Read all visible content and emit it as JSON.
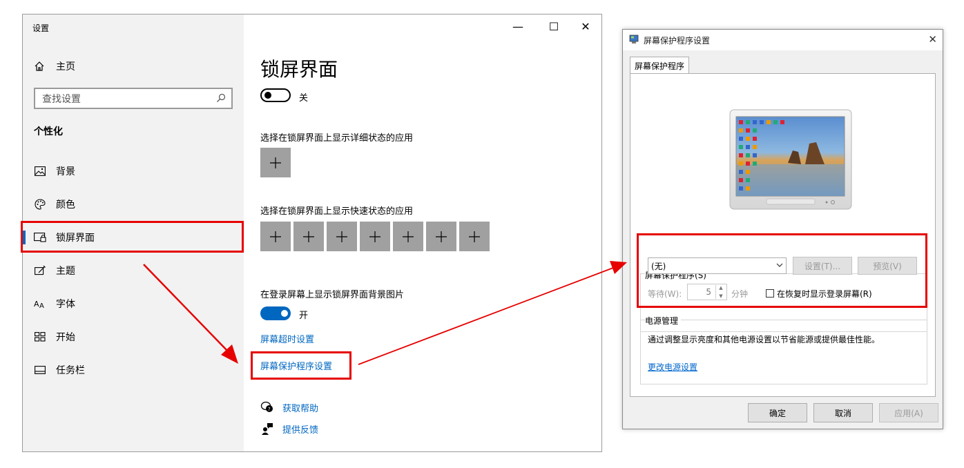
{
  "settings": {
    "app_title": "设置",
    "home_label": "主页",
    "search_placeholder": "查找设置",
    "section_label": "个性化",
    "nav": [
      {
        "label": "背景",
        "icon": "picture-icon"
      },
      {
        "label": "颜色",
        "icon": "palette-icon"
      },
      {
        "label": "锁屏界面",
        "icon": "lockscreen-icon",
        "active": true
      },
      {
        "label": "主题",
        "icon": "theme-icon"
      },
      {
        "label": "字体",
        "icon": "font-icon"
      },
      {
        "label": "开始",
        "icon": "start-icon"
      },
      {
        "label": "任务栏",
        "icon": "taskbar-icon"
      }
    ],
    "window_controls": {
      "minimize": "—",
      "maximize": "☐",
      "close": "✕"
    },
    "main": {
      "title": "锁屏界面",
      "toggle1_state": "关",
      "detailed_status_label": "选择在锁屏界面上显示详细状态的应用",
      "quick_status_label": "选择在锁屏界面上显示快速状态的应用",
      "quick_slots": 7,
      "signin_bg_label": "在登录屏幕上显示锁屏界面背景图片",
      "toggle2_state": "开",
      "timeout_link": "屏幕超时设置",
      "screensaver_link": "屏幕保护程序设置",
      "help_link": "获取帮助",
      "feedback_link": "提供反馈"
    }
  },
  "dialog": {
    "title": "屏幕保护程序设置",
    "close": "✕",
    "tab_label": "屏幕保护程序",
    "screensaver_group_label": "屏幕保护程序(S)",
    "selected_screensaver": "(无)",
    "settings_button": "设置(T)...",
    "preview_button": "预览(V)",
    "wait_label": "等待(W):",
    "wait_value": "5",
    "minutes_label": "分钟",
    "resume_checkbox_label": "在恢复时显示登录屏幕(R)",
    "resume_checked": false,
    "power_group_label": "电源管理",
    "power_text": "通过调整显示亮度和其他电源设置以节省能源或提供最佳性能。",
    "power_link": "更改电源设置",
    "ok_button": "确定",
    "cancel_button": "取消",
    "apply_button": "应用(A)"
  },
  "colors": {
    "accent": "#0067c0",
    "annotation_red": "#e60000",
    "sidebar_bg": "#f2f2f2",
    "tile_gray": "#a0a0a0"
  }
}
